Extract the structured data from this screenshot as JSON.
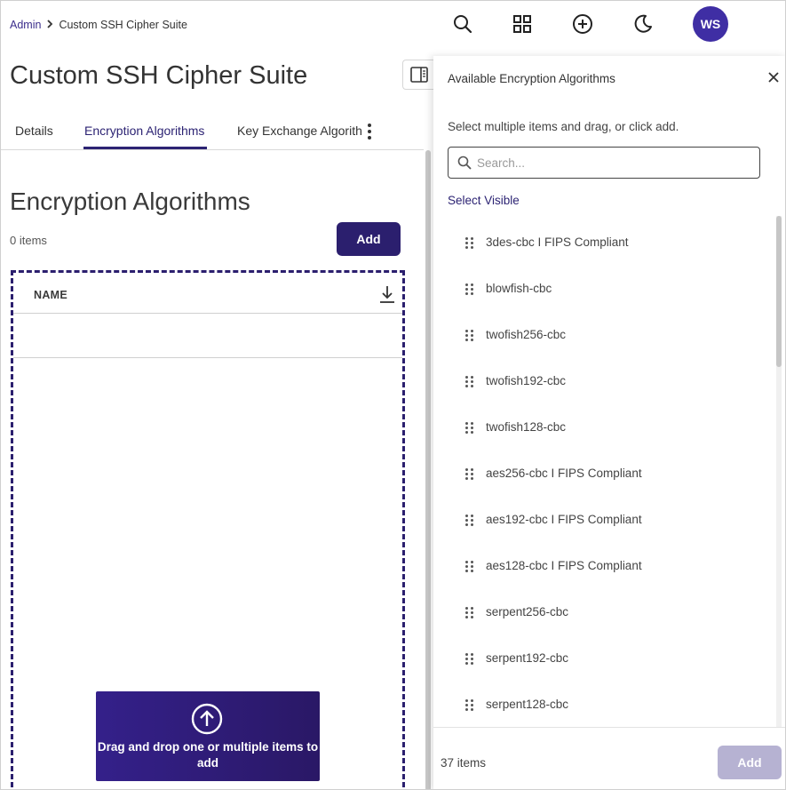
{
  "breadcrumb": {
    "root": "Admin",
    "current": "Custom SSH Cipher Suite"
  },
  "header": {
    "icons": [
      "search-icon",
      "apps-grid-icon",
      "add-circle-icon",
      "moon-icon"
    ],
    "avatar_initials": "WS",
    "avatar_color": "#3f2ea4"
  },
  "page": {
    "title": "Custom SSH Cipher Suite",
    "tabs": [
      {
        "label": "Details"
      },
      {
        "label": "Encryption Algorithms",
        "active": true
      },
      {
        "label": "Key Exchange Algorithr"
      }
    ]
  },
  "section": {
    "title": "Encryption Algorithms",
    "count": "0 items",
    "add_label": "Add",
    "table_header": "NAME",
    "dropzone_text": "Drag and drop one or multiple items to add"
  },
  "drawer": {
    "title": "Available Encryption Algorithms",
    "hint": "Select multiple items and drag, or click add.",
    "search_placeholder": "Search...",
    "select_visible": "Select Visible",
    "items": [
      "3des-cbc I FIPS Compliant",
      "blowfish-cbc",
      "twofish256-cbc",
      "twofish192-cbc",
      "twofish128-cbc",
      "aes256-cbc I FIPS Compliant",
      "aes192-cbc I FIPS Compliant",
      "aes128-cbc I FIPS Compliant",
      "serpent256-cbc",
      "serpent192-cbc",
      "serpent128-cbc"
    ],
    "count": "37 items",
    "add_label": "Add"
  },
  "colors": {
    "primary": "#2b1f6e",
    "accent_link": "#2c2373",
    "disabled_button": "#b6b2d2"
  }
}
